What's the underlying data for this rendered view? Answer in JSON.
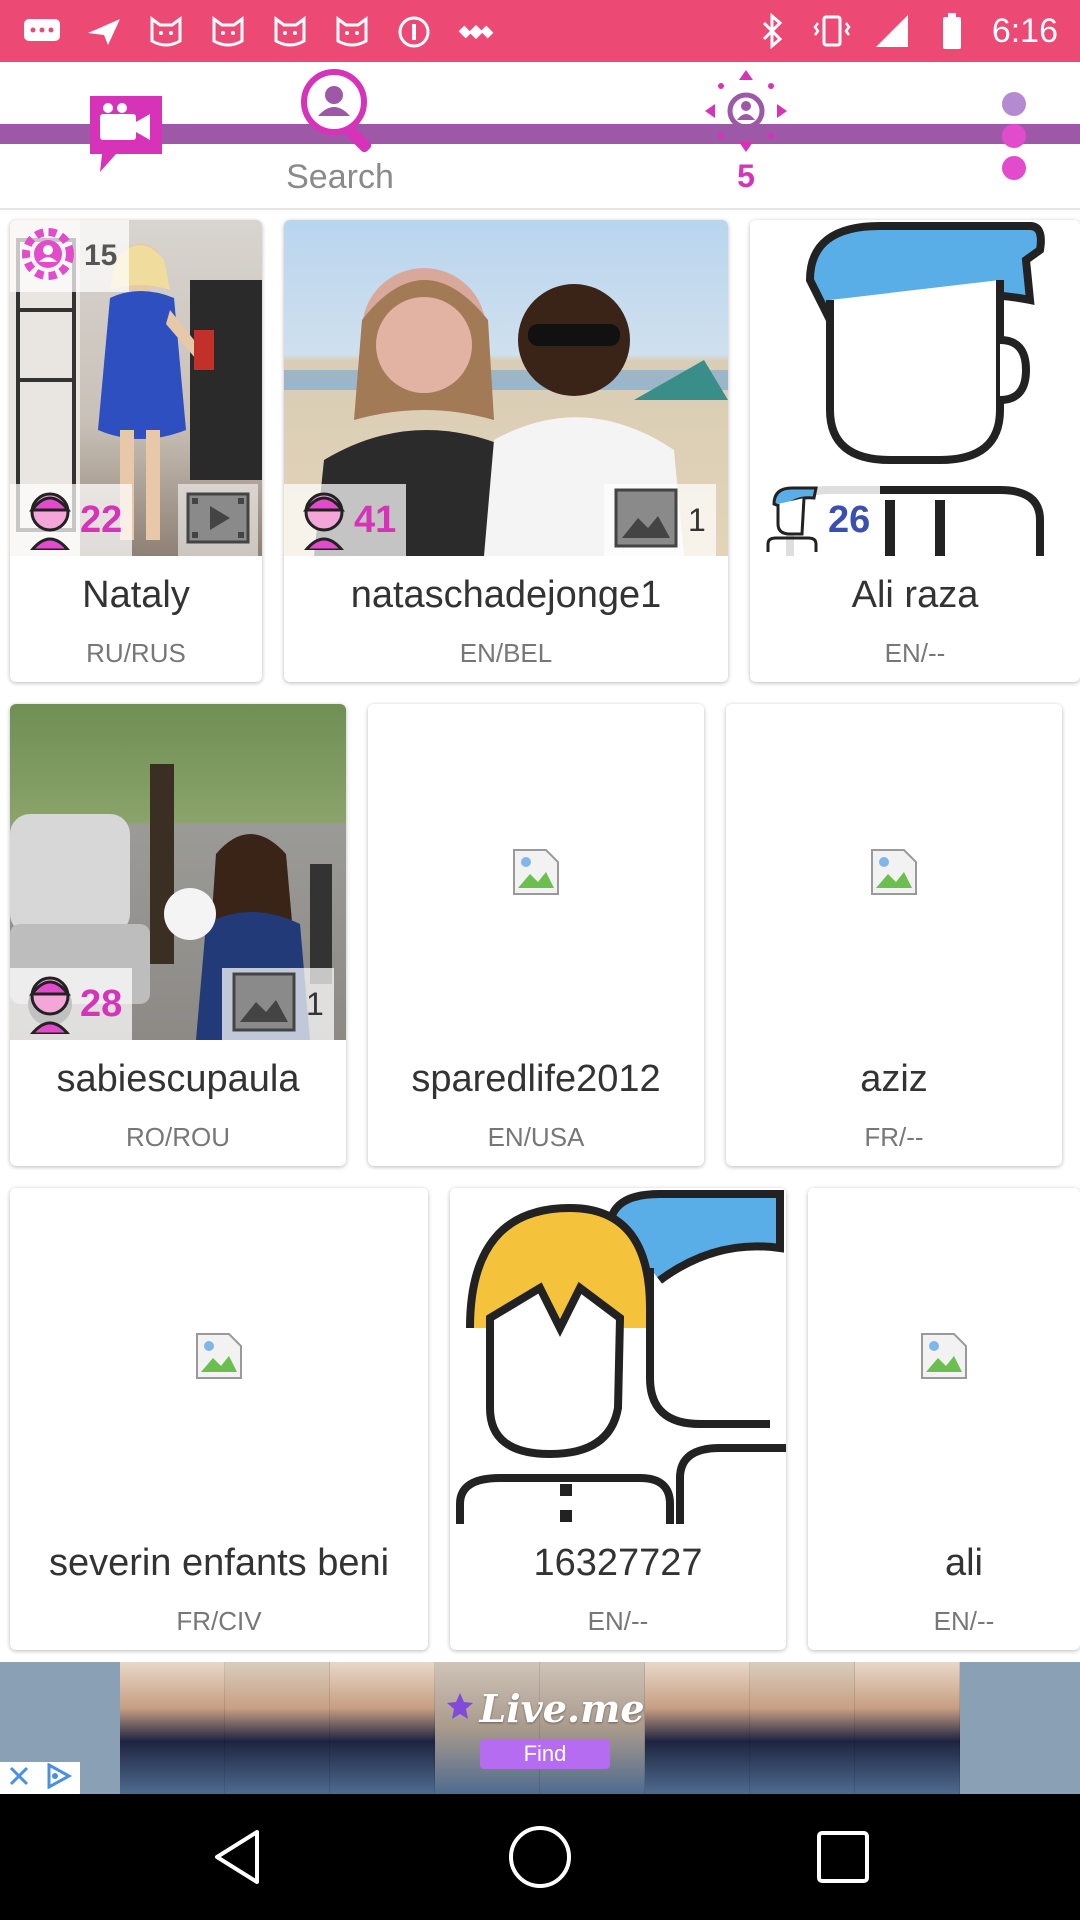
{
  "status_bar": {
    "time": "6:16",
    "left_icons": [
      "message-icon",
      "location-arrow-icon",
      "cat-icon",
      "cat-icon",
      "cat-icon",
      "cat-icon",
      "info-icon",
      "satellite-icon"
    ],
    "right_icons": [
      "bluetooth-icon",
      "vibrate-icon",
      "signal-icon",
      "battery-icon"
    ]
  },
  "toolbar": {
    "video_chat_icon": "video-chat-icon",
    "search_label": "Search",
    "nearby_count": "5",
    "menu_icon": "more-vert-icon",
    "accent_color": "#9d58a7",
    "highlight_color": "#d633b9"
  },
  "profiles": [
    {
      "name": "Nataly",
      "lang": "RU/RUS",
      "age": "22",
      "views": "15",
      "has_video": true,
      "gender": "female"
    },
    {
      "name": "nataschadejonge1",
      "lang": "EN/BEL",
      "age": "41",
      "photos": "1",
      "gender": "female"
    },
    {
      "name": "Ali raza",
      "lang": "EN/--",
      "age": "26",
      "gender": "male",
      "placeholder": "male-avatar"
    },
    {
      "name": "sabiescupaula",
      "lang": "RO/ROU",
      "age": "28",
      "photos": "1",
      "gender": "female"
    },
    {
      "name": "sparedlife2012",
      "lang": "EN/USA",
      "placeholder": "broken-image"
    },
    {
      "name": "aziz",
      "lang": "FR/--",
      "placeholder": "broken-image"
    },
    {
      "name": "severin enfants beni",
      "lang": "FR/CIV",
      "placeholder": "broken-image"
    },
    {
      "name": "16327727",
      "lang": "EN/--",
      "placeholder": "couple-avatar"
    },
    {
      "name": "ali",
      "lang": "EN/--",
      "placeholder": "broken-image"
    }
  ],
  "ad": {
    "brand": "Live.me",
    "cta": "Find"
  }
}
